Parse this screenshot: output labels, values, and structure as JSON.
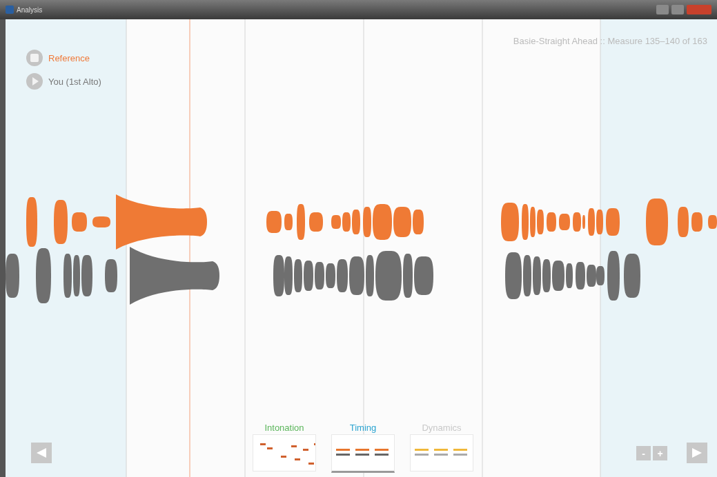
{
  "window": {
    "title": "Analysis"
  },
  "tracks": [
    {
      "label": "Reference",
      "selected": true
    },
    {
      "label": "You (1st Alto)",
      "selected": false
    }
  ],
  "piece_info": "Basie-Straight Ahead :: Measure 135–140 of 163",
  "views": [
    {
      "label": "Intonation",
      "color": "#5ab55a",
      "selected": false
    },
    {
      "label": "Timing",
      "color": "#2aa3d0",
      "selected": true
    },
    {
      "label": "Dynamics",
      "color": "#c8c8c8",
      "selected": false
    }
  ],
  "zoom_buttons": [
    "-",
    "+"
  ]
}
